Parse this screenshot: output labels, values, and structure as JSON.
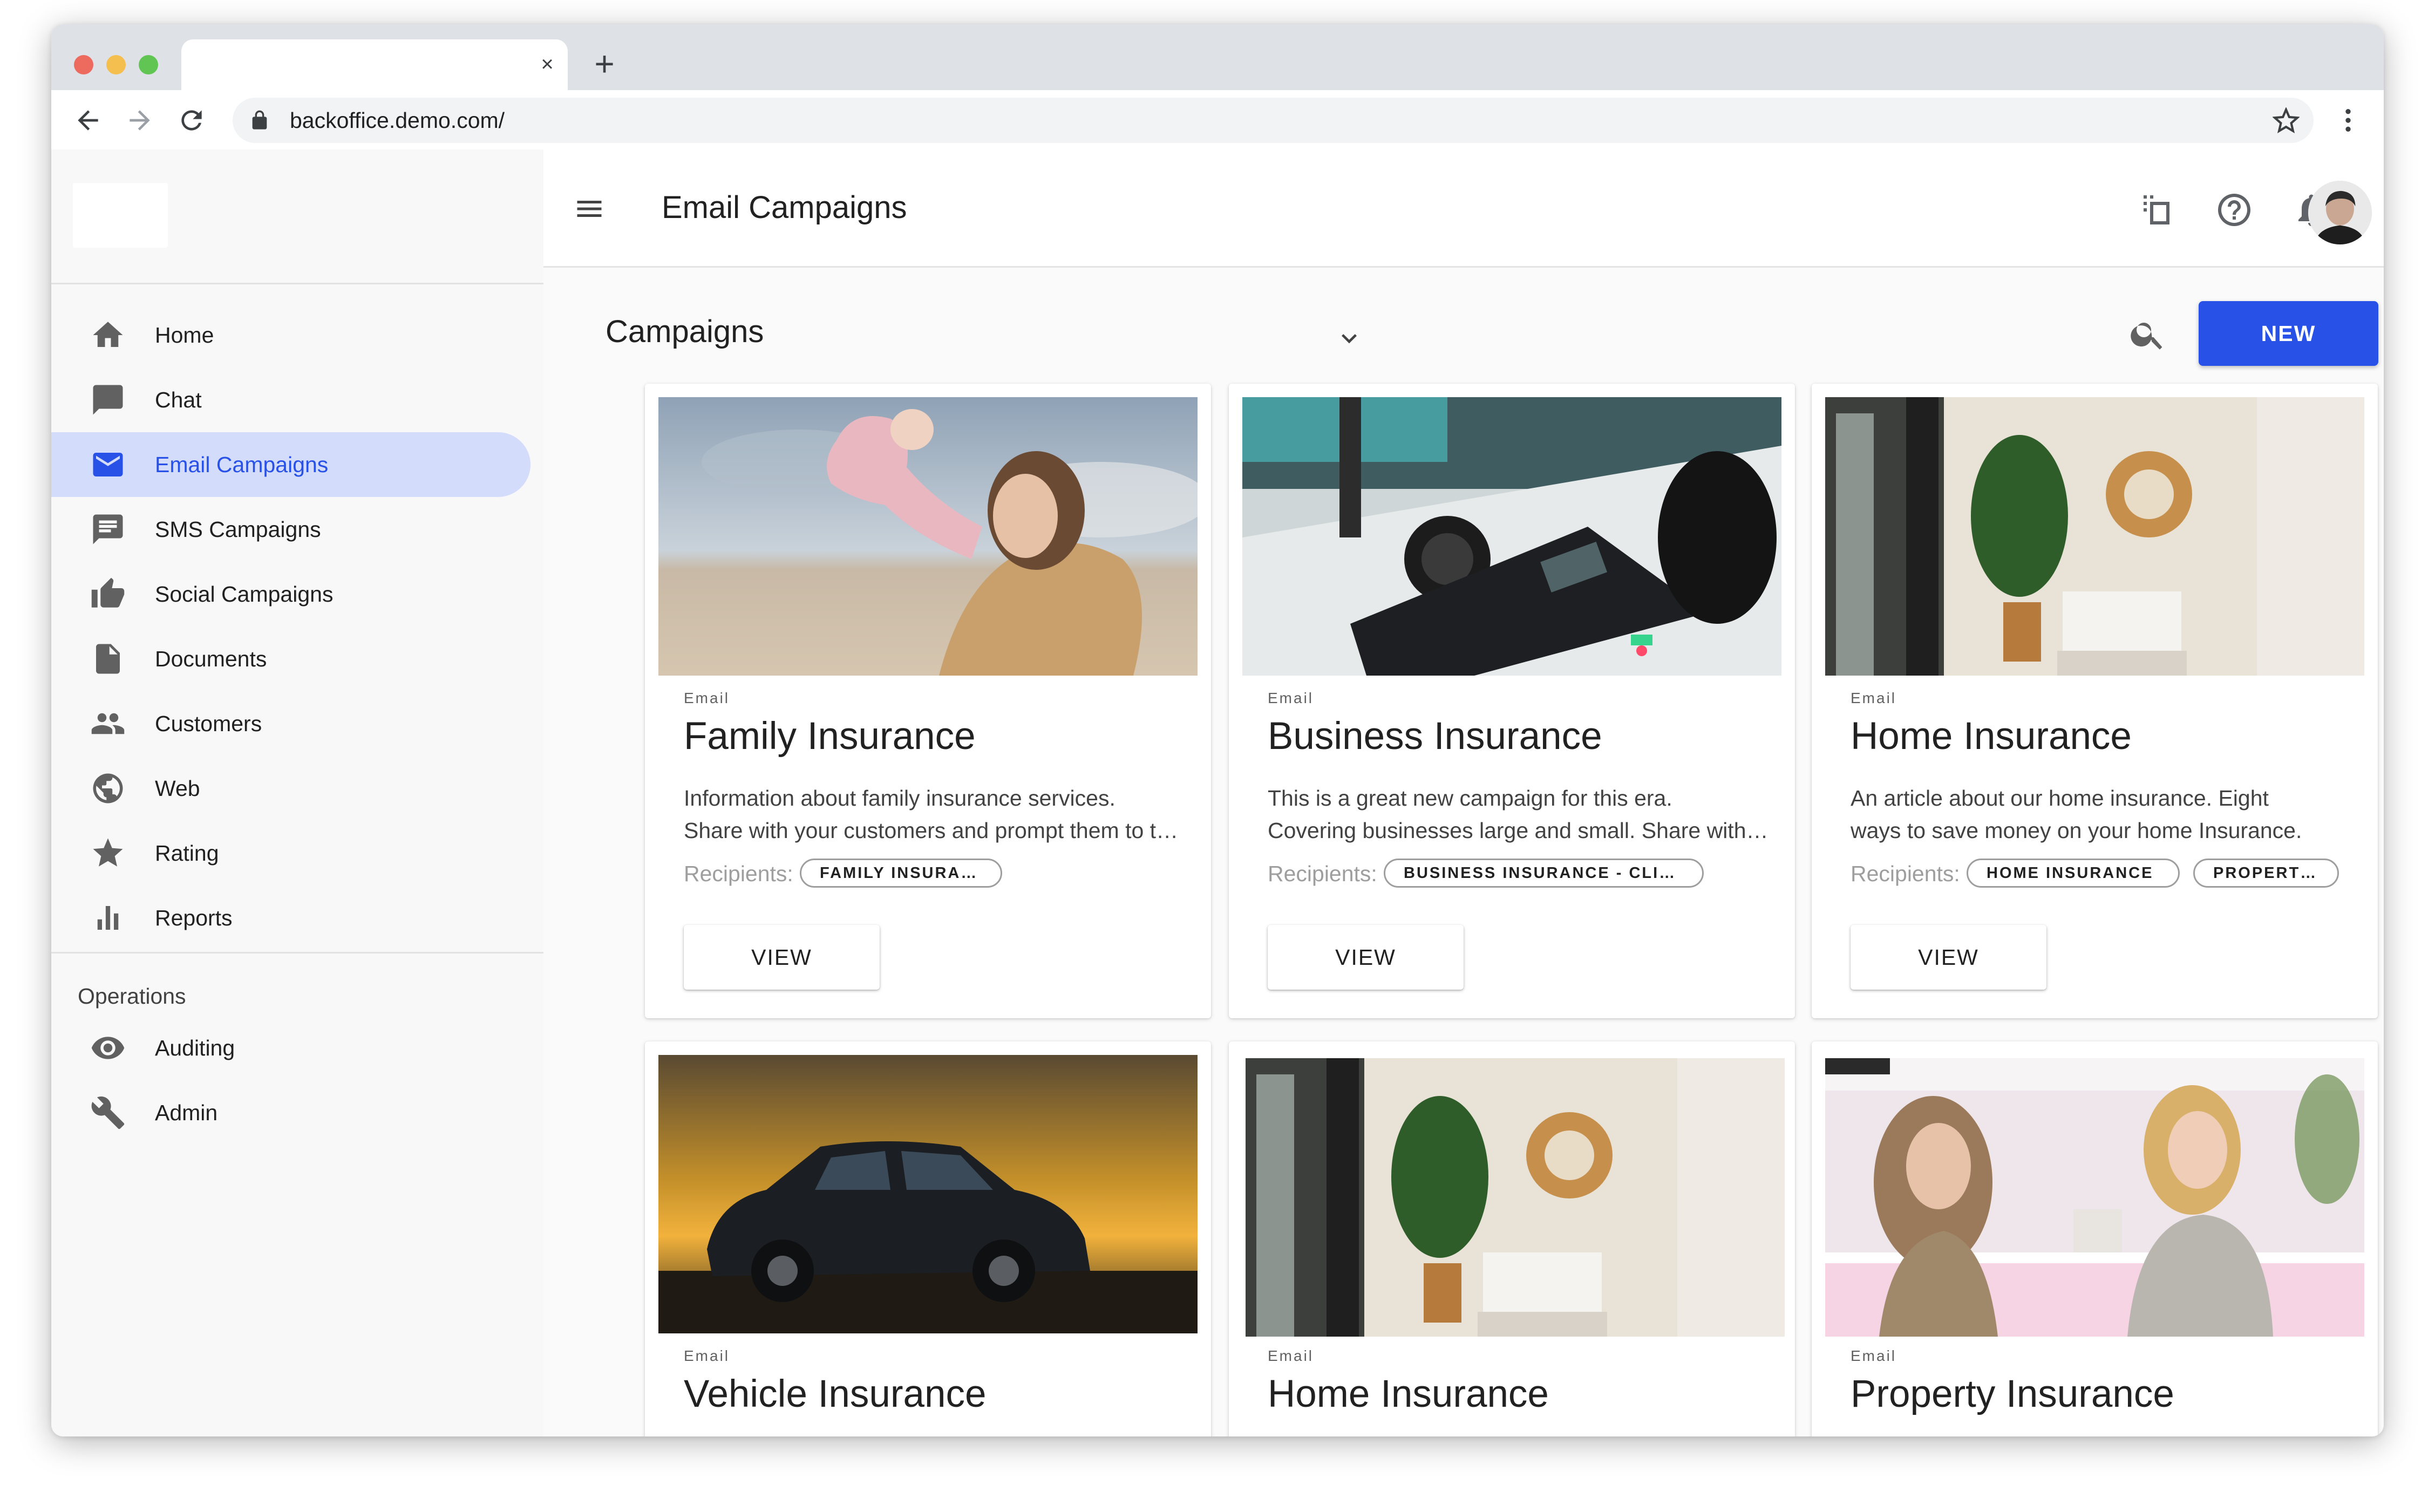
{
  "browser": {
    "url": "backoffice.demo.com/",
    "tab_close": "×",
    "new_tab": "+"
  },
  "header": {
    "title": "Email Campaigns"
  },
  "sidebar": {
    "items": [
      {
        "label": "Home",
        "icon": "home-icon"
      },
      {
        "label": "Chat",
        "icon": "chat-icon"
      },
      {
        "label": "Email Campaigns",
        "icon": "email-icon",
        "active": true
      },
      {
        "label": "SMS Campaigns",
        "icon": "sms-icon"
      },
      {
        "label": "Social Campaigns",
        "icon": "thumb-up-icon"
      },
      {
        "label": "Documents",
        "icon": "document-icon"
      },
      {
        "label": "Customers",
        "icon": "people-icon"
      },
      {
        "label": "Web",
        "icon": "globe-icon"
      },
      {
        "label": "Rating",
        "icon": "star-icon"
      },
      {
        "label": "Reports",
        "icon": "bar-chart-icon"
      }
    ],
    "section_label": "Operations",
    "ops_items": [
      {
        "label": "Auditing",
        "icon": "eye-icon"
      },
      {
        "label": "Admin",
        "icon": "wrench-icon"
      }
    ]
  },
  "toolbar": {
    "section_title": "Campaigns",
    "new_label": "NEW"
  },
  "colors": {
    "accent": "#2851e8",
    "active_bg": "#d4dcfb"
  },
  "cards": [
    {
      "overline": "Email",
      "title": "Family Insurance",
      "desc1": "Information about family insurance services.",
      "desc2": "Share with your customers and prompt them to take action.",
      "recipients_label": "Recipients:",
      "chips": [
        "FAMILY INSURANCE"
      ],
      "view_label": "VIEW"
    },
    {
      "overline": "Email",
      "title": "Business Insurance",
      "desc1": "This is a great new campaign for this era.",
      "desc2": "Covering businesses large and small. Share with your customers.",
      "recipients_label": "Recipients:",
      "chips": [
        "BUSINESS INSURANCE - CLIENTS"
      ],
      "view_label": "VIEW"
    },
    {
      "overline": "Email",
      "title": "Home Insurance",
      "desc1": "An article about our home insurance. Eight",
      "desc2": "ways to save money on your home Insurance.",
      "recipients_label": "Recipients:",
      "chips": [
        "HOME INSURANCE",
        "PROPERTY INSURANCE"
      ],
      "view_label": "VIEW"
    },
    {
      "overline": "Email",
      "title": "Vehicle Insurance"
    },
    {
      "overline": "Email",
      "title": "Home Insurance"
    },
    {
      "overline": "Email",
      "title": "Property Insurance"
    }
  ]
}
